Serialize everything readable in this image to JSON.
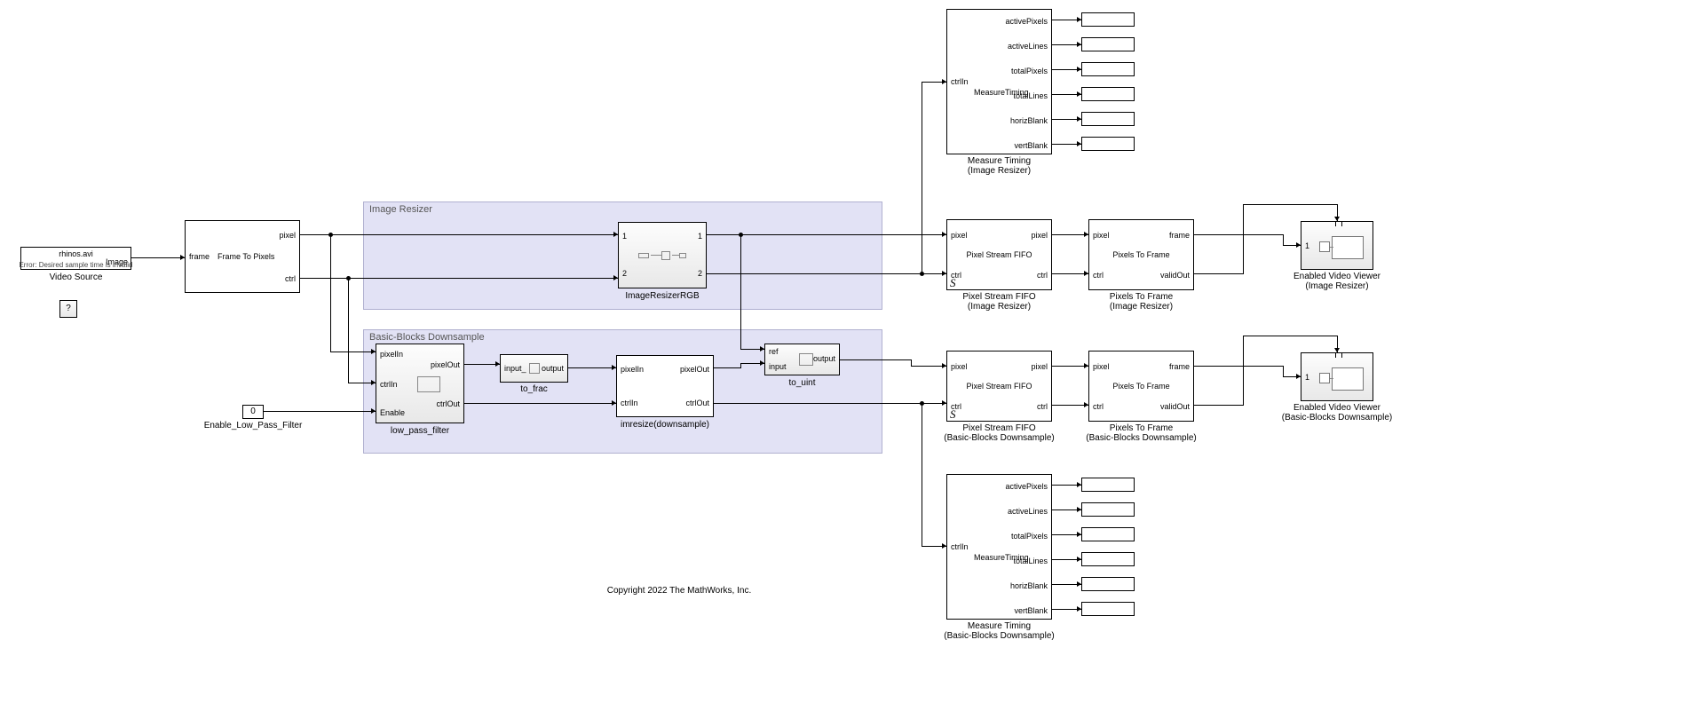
{
  "blocks": {
    "video_source": {
      "line1": "rhinos.avi",
      "line2": "Image",
      "error": "Error: Desired sample time is invalid",
      "caption": "Video Source"
    },
    "question": "?",
    "frame2pix": {
      "in": "frame",
      "name": "Frame To Pixels",
      "out1": "pixel",
      "out2": "ctrl"
    },
    "enable_const": {
      "value": "0",
      "caption": "Enable_Low_Pass_Filter"
    },
    "area_resizer": "Image Resizer",
    "area_basic": "Basic-Blocks Downsample",
    "imresizer": {
      "caption": "ImageResizerRGB",
      "p1": "1",
      "p2": "2",
      "o1": "1",
      "o2": "2"
    },
    "lpf": {
      "caption": "low_pass_filter",
      "in1": "pixelIn",
      "in2": "ctrlIn",
      "in3": "Enable",
      "out1": "pixelOut",
      "out2": "ctrlOut"
    },
    "tofrac": {
      "caption": "to_frac",
      "in": "input_",
      "out": "output"
    },
    "ds": {
      "caption": "imresize(downsample)",
      "in1": "pixelIn",
      "in2": "ctrlIn",
      "out1": "pixelOut",
      "out2": "ctrlOut"
    },
    "touint": {
      "caption": "to_uint",
      "in1": "ref",
      "in2": "input",
      "out": "output"
    },
    "fifo1": {
      "caption": "Pixel Stream FIFO",
      "sub": "(Image Resizer)",
      "in1": "pixel",
      "in2": "ctrl",
      "out1": "pixel",
      "out2": "ctrl"
    },
    "fifo2": {
      "caption": "Pixel Stream FIFO",
      "sub": "(Basic-Blocks Downsample)",
      "in1": "pixel",
      "in2": "ctrl",
      "out1": "pixel",
      "out2": "ctrl"
    },
    "p2f1": {
      "caption": "Pixels To Frame",
      "sub": "(Image Resizer)",
      "in1": "pixel",
      "in2": "ctrl",
      "out1": "frame",
      "out2": "validOut"
    },
    "p2f2": {
      "caption": "Pixels To Frame",
      "sub": "(Basic-Blocks Downsample)",
      "in1": "pixel",
      "in2": "ctrl",
      "out1": "frame",
      "out2": "validOut"
    },
    "viewer1": {
      "caption": "Enabled Video Viewer",
      "sub": "(Image Resizer)",
      "p": "1"
    },
    "viewer2": {
      "caption": "Enabled Video Viewer",
      "sub": "(Basic-Blocks Downsample)",
      "p": "1"
    },
    "mt1": {
      "caption": "Measure Timing",
      "sub": "(Image Resizer)",
      "in": "ctrlIn",
      "name": "MeasureTiming",
      "p": [
        "activePixels",
        "activeLines",
        "totalPixels",
        "totalLines",
        "horizBlank",
        "vertBlank"
      ]
    },
    "mt2": {
      "caption": "Measure Timing",
      "sub": "(Basic-Blocks Downsample)",
      "in": "ctrlIn",
      "name": "MeasureTiming",
      "p": [
        "activePixels",
        "activeLines",
        "totalPixels",
        "totalLines",
        "horizBlank",
        "vertBlank"
      ]
    }
  },
  "copyright": "Copyright 2022 The MathWorks, Inc."
}
